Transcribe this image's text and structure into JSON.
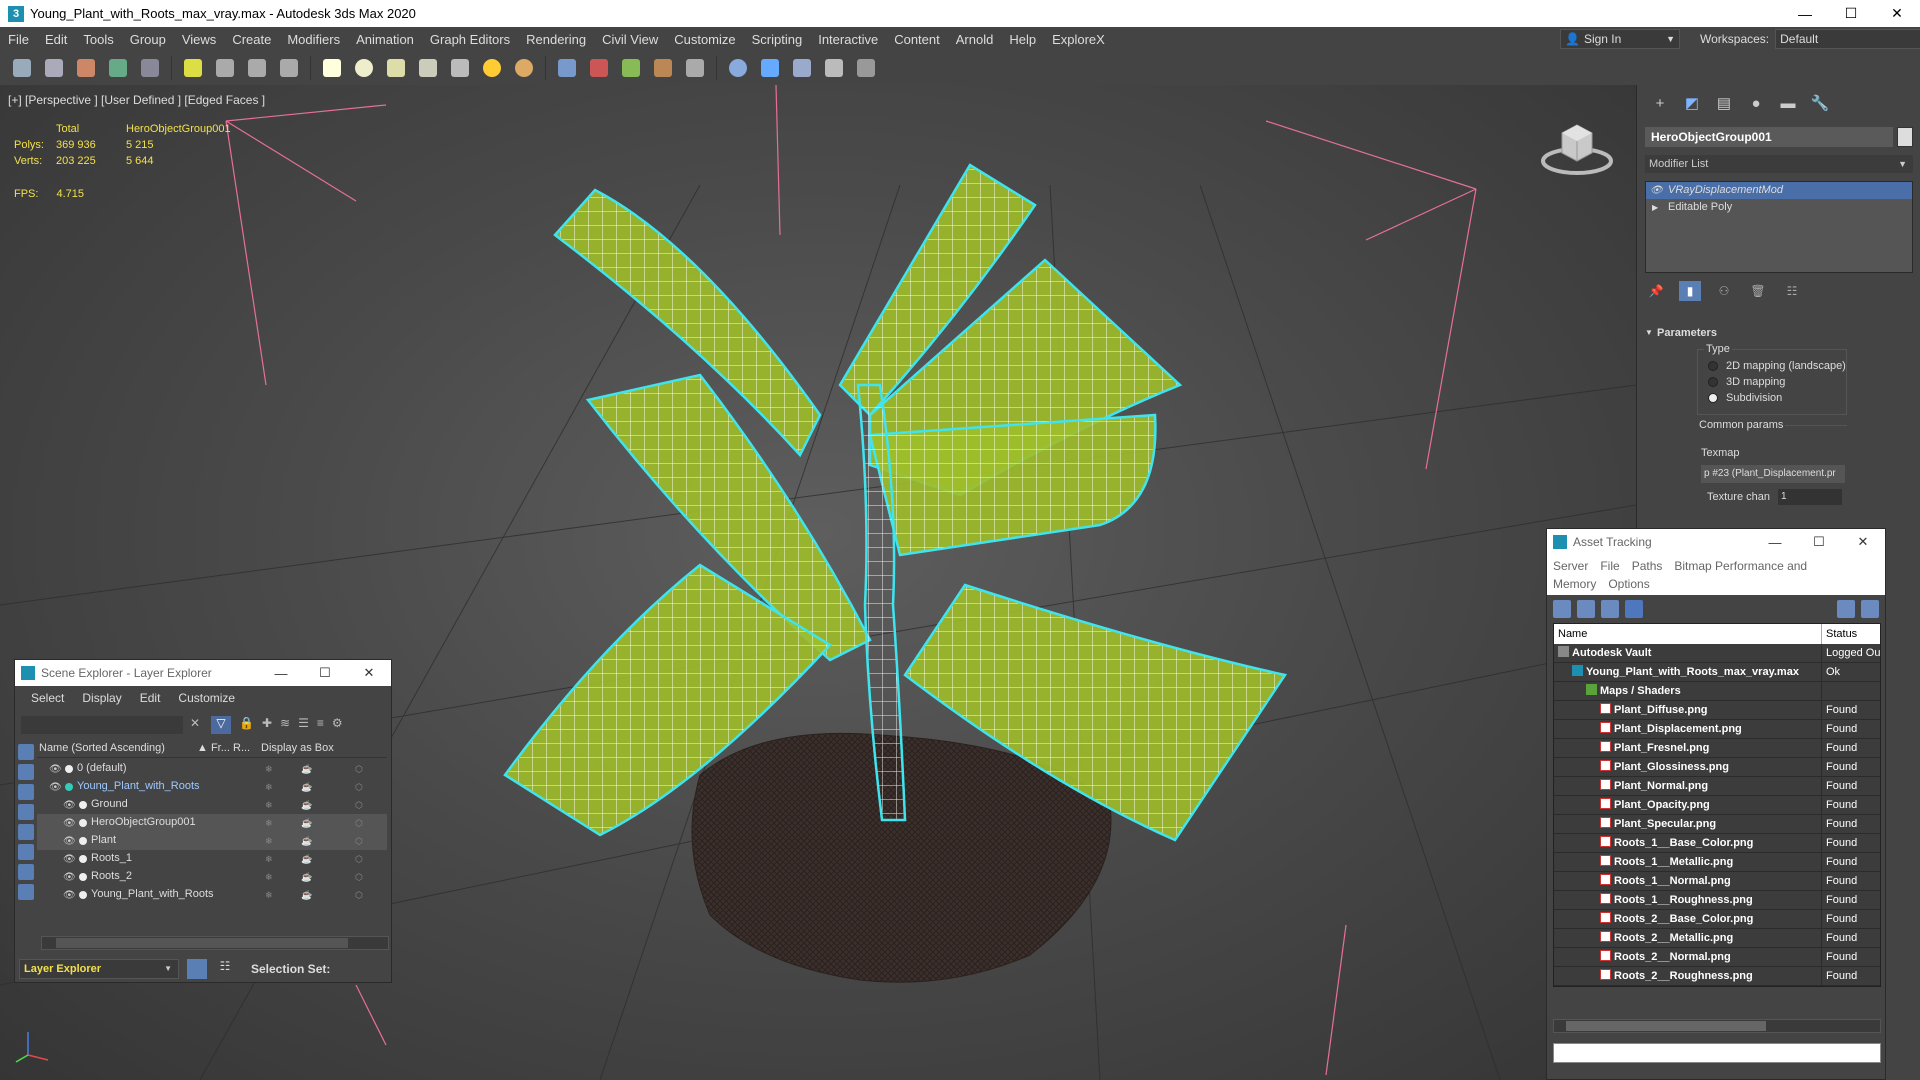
{
  "window": {
    "title": "Young_Plant_with_Roots_max_vray.max - Autodesk 3ds Max 2020",
    "icon": "3",
    "minimize": "—",
    "maximize": "☐",
    "close": "✕"
  },
  "menu": [
    "File",
    "Edit",
    "Tools",
    "Group",
    "Views",
    "Create",
    "Modifiers",
    "Animation",
    "Graph Editors",
    "Rendering",
    "Civil View",
    "Customize",
    "Scripting",
    "Interactive",
    "Content",
    "Arnold",
    "Help",
    "ExploreX"
  ],
  "signin": {
    "label": "Sign In"
  },
  "workspaces": {
    "label": "Workspaces:",
    "value": "Default"
  },
  "toolbar_icons": [
    "select-icon",
    "lasso-icon",
    "render-setup-icon",
    "material-editor-icon",
    "schematic-icon",
    "light-bulb-icon",
    "move-icon",
    "rotate-icon",
    "scale-icon",
    "box-icon",
    "sphere-icon",
    "torus-icon",
    "teapot-icon",
    "cone-icon",
    "sun-icon",
    "dome-light-icon",
    "particle-icon",
    "physics-icon",
    "hair-icon",
    "fur-icon",
    "hf-icon",
    "sphere-render-icon",
    "render-icon",
    "render-frame-icon",
    "batch-render-icon",
    "help-icon"
  ],
  "viewport": {
    "label": "[+] [Perspective ] [User Defined ] [Edged Faces ]",
    "stats": {
      "header_total": "Total",
      "header_object": "HeroObjectGroup001",
      "polys_label": "Polys:",
      "polys_total": "369 936",
      "polys_object": "5 215",
      "verts_label": "Verts:",
      "verts_total": "203 225",
      "verts_object": "5 644",
      "fps_label": "FPS:",
      "fps_value": "4.715"
    }
  },
  "command_panel": {
    "tabs": [
      "create-icon",
      "modify-icon",
      "hierarchy-icon",
      "motion-icon",
      "display-icon",
      "utilities-icon"
    ],
    "object_name": "HeroObjectGroup001",
    "modifier_list": "Modifier List",
    "stack": [
      {
        "name": "VRayDisplacementMod",
        "selected": true
      },
      {
        "name": "Editable Poly",
        "selected": false
      }
    ],
    "parameters": {
      "title": "Parameters",
      "type_label": "Type",
      "options": [
        {
          "label": "2D mapping (landscape)",
          "checked": false
        },
        {
          "label": "3D mapping",
          "checked": false
        },
        {
          "label": "Subdivision",
          "checked": true
        }
      ],
      "common_label": "Common params",
      "texmap_label": "Texmap",
      "texmap_value": "p #23 (Plant_Displacement.pr",
      "texchan_label": "Texture chan",
      "texchan_value": "1"
    }
  },
  "scene_explorer": {
    "title": "Scene Explorer - Layer Explorer",
    "menu": [
      "Select",
      "Display",
      "Edit",
      "Customize"
    ],
    "columns": [
      "Name (Sorted Ascending)",
      "▲ Fr...",
      "R...",
      "Display as Box"
    ],
    "rows": [
      {
        "name": "0 (default)",
        "indent": 1,
        "highlight": false
      },
      {
        "name": "Young_Plant_with_Roots",
        "indent": 1,
        "highlight": false,
        "layer": true
      },
      {
        "name": "Ground",
        "indent": 2,
        "highlight": false
      },
      {
        "name": "HeroObjectGroup001",
        "indent": 2,
        "highlight": true
      },
      {
        "name": "Plant",
        "indent": 2,
        "highlight": true
      },
      {
        "name": "Roots_1",
        "indent": 2,
        "highlight": false
      },
      {
        "name": "Roots_2",
        "indent": 2,
        "highlight": false
      },
      {
        "name": "Young_Plant_with_Roots",
        "indent": 2,
        "highlight": false
      }
    ],
    "bottom_dropdown": "Layer Explorer",
    "selection_set": "Selection Set:"
  },
  "asset_tracking": {
    "title": "Asset Tracking",
    "menu": [
      "Server",
      "File",
      "Paths",
      "Bitmap Performance and Memory",
      "Options"
    ],
    "columns": {
      "name": "Name",
      "status": "Status"
    },
    "rows": [
      {
        "name": "Autodesk Vault",
        "status": "Logged Ou",
        "indent": 1,
        "icon": "vault"
      },
      {
        "name": "Young_Plant_with_Roots_max_vray.max",
        "status": "Ok",
        "indent": 2,
        "icon": "max"
      },
      {
        "name": "Maps / Shaders",
        "status": "",
        "indent": 3,
        "icon": "folder"
      },
      {
        "name": "Plant_Diffuse.png",
        "status": "Found",
        "indent": 4,
        "icon": "png"
      },
      {
        "name": "Plant_Displacement.png",
        "status": "Found",
        "indent": 4,
        "icon": "png"
      },
      {
        "name": "Plant_Fresnel.png",
        "status": "Found",
        "indent": 4,
        "icon": "png"
      },
      {
        "name": "Plant_Glossiness.png",
        "status": "Found",
        "indent": 4,
        "icon": "png"
      },
      {
        "name": "Plant_Normal.png",
        "status": "Found",
        "indent": 4,
        "icon": "png"
      },
      {
        "name": "Plant_Opacity.png",
        "status": "Found",
        "indent": 4,
        "icon": "png"
      },
      {
        "name": "Plant_Specular.png",
        "status": "Found",
        "indent": 4,
        "icon": "png"
      },
      {
        "name": "Roots_1__Base_Color.png",
        "status": "Found",
        "indent": 4,
        "icon": "png"
      },
      {
        "name": "Roots_1__Metallic.png",
        "status": "Found",
        "indent": 4,
        "icon": "png"
      },
      {
        "name": "Roots_1__Normal.png",
        "status": "Found",
        "indent": 4,
        "icon": "png"
      },
      {
        "name": "Roots_1__Roughness.png",
        "status": "Found",
        "indent": 4,
        "icon": "png"
      },
      {
        "name": "Roots_2__Base_Color.png",
        "status": "Found",
        "indent": 4,
        "icon": "png"
      },
      {
        "name": "Roots_2__Metallic.png",
        "status": "Found",
        "indent": 4,
        "icon": "png"
      },
      {
        "name": "Roots_2__Normal.png",
        "status": "Found",
        "indent": 4,
        "icon": "png"
      },
      {
        "name": "Roots_2__Roughness.png",
        "status": "Found",
        "indent": 4,
        "icon": "png"
      }
    ]
  },
  "colors": {
    "wire_highlight": "#3fe4ee",
    "leaf_green": "#9fbe2a",
    "stats_yellow": "#f2e04a",
    "selected_blue": "#4a6ea8"
  }
}
